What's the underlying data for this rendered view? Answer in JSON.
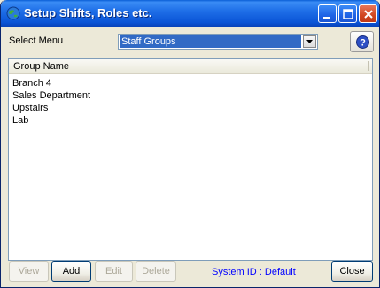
{
  "window": {
    "title": "Setup Shifts, Roles etc.",
    "icon": "app-globe-icon"
  },
  "toolbar": {
    "select_label": "Select Menu",
    "select_value": "Staff Groups",
    "help_icon": "help-icon"
  },
  "list": {
    "column_header": "Group Name",
    "rows": [
      "Branch 4",
      "Sales Department",
      "Upstairs",
      "Lab"
    ]
  },
  "footer": {
    "view_label": "View",
    "add_label": "Add",
    "edit_label": "Edit",
    "delete_label": "Delete",
    "system_id": "System ID : Default",
    "close_label": "Close"
  },
  "colors": {
    "titlebar": "#0a54d6",
    "selection": "#316ac5",
    "link": "#0000ff"
  }
}
